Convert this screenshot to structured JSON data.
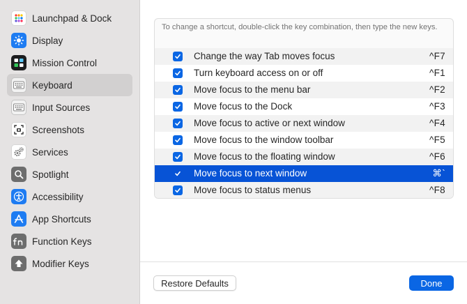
{
  "sidebar": {
    "items": [
      {
        "label": "Launchpad & Dock",
        "icon": "launchpad-icon",
        "selected": false
      },
      {
        "label": "Display",
        "icon": "display-icon",
        "selected": false
      },
      {
        "label": "Mission Control",
        "icon": "mission-control-icon",
        "selected": false
      },
      {
        "label": "Keyboard",
        "icon": "keyboard-icon",
        "selected": true
      },
      {
        "label": "Input Sources",
        "icon": "input-sources-icon",
        "selected": false
      },
      {
        "label": "Screenshots",
        "icon": "screenshots-icon",
        "selected": false
      },
      {
        "label": "Services",
        "icon": "services-icon",
        "selected": false
      },
      {
        "label": "Spotlight",
        "icon": "spotlight-icon",
        "selected": false
      },
      {
        "label": "Accessibility",
        "icon": "accessibility-icon",
        "selected": false
      },
      {
        "label": "App Shortcuts",
        "icon": "app-shortcuts-icon",
        "selected": false
      },
      {
        "label": "Function Keys",
        "icon": "function-keys-icon",
        "selected": false
      },
      {
        "label": "Modifier Keys",
        "icon": "modifier-keys-icon",
        "selected": false
      }
    ]
  },
  "panel": {
    "description": "To change a shortcut, double-click the key combination, then type the new keys.",
    "shortcuts": [
      {
        "label": "Change the way Tab moves focus",
        "key": "^F7",
        "checked": true,
        "selected": false
      },
      {
        "label": "Turn keyboard access on or off",
        "key": "^F1",
        "checked": true,
        "selected": false
      },
      {
        "label": "Move focus to the menu bar",
        "key": "^F2",
        "checked": true,
        "selected": false
      },
      {
        "label": "Move focus to the Dock",
        "key": "^F3",
        "checked": true,
        "selected": false
      },
      {
        "label": "Move focus to active or next window",
        "key": "^F4",
        "checked": true,
        "selected": false
      },
      {
        "label": "Move focus to the window toolbar",
        "key": "^F5",
        "checked": true,
        "selected": false
      },
      {
        "label": "Move focus to the floating window",
        "key": "^F6",
        "checked": true,
        "selected": false
      },
      {
        "label": "Move focus to next window",
        "key": "⌘`",
        "checked": true,
        "selected": true
      },
      {
        "label": "Move focus to status menus",
        "key": "^F8",
        "checked": true,
        "selected": false
      }
    ]
  },
  "footer": {
    "restore_label": "Restore Defaults",
    "done_label": "Done"
  },
  "colors": {
    "accent": "#0a66e4",
    "selection": "#0753d6",
    "sidebar_bg": "#e5e3e3"
  }
}
